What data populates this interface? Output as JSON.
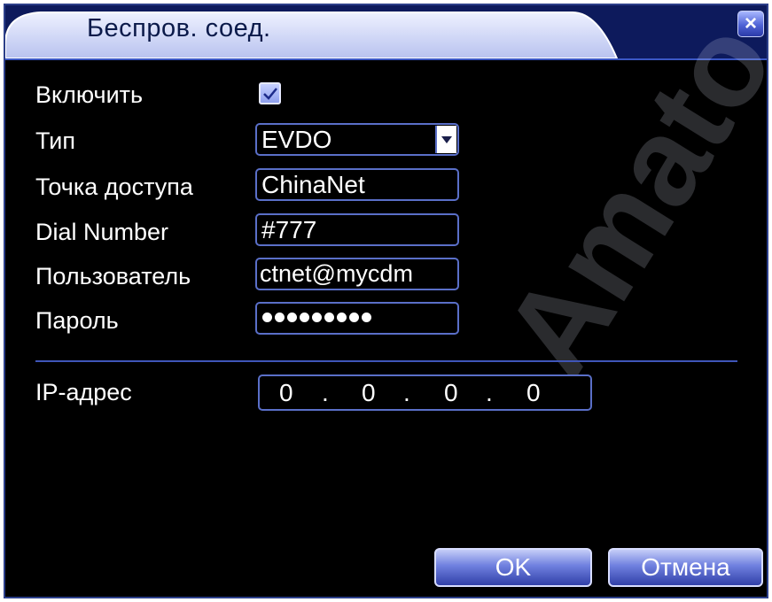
{
  "window": {
    "title": "Беспров. соед.",
    "close_icon": "close-icon"
  },
  "form": {
    "enable": {
      "label": "Включить",
      "checked": true
    },
    "type": {
      "label": "Тип",
      "value": "EVDO"
    },
    "access_point": {
      "label": "Точка доступа",
      "value": "ChinaNet"
    },
    "dial_number": {
      "label": "Dial Number",
      "value": "#777"
    },
    "user": {
      "label": "Пользователь",
      "value": "ctnet@mycdm"
    },
    "password": {
      "label": "Пароль",
      "masked_length": 9
    },
    "ip_address": {
      "label": "IP-адрес",
      "octets": [
        "0",
        "0",
        "0",
        "0"
      ],
      "separator": "."
    }
  },
  "buttons": {
    "ok": "OK",
    "cancel": "Отмена"
  },
  "watermark": "Amato",
  "colors": {
    "background": "#000000",
    "accent_border": "#5a6fc8",
    "titlebar": "#d2d8f8",
    "button": "#6f80df",
    "text": "#ffffff"
  }
}
